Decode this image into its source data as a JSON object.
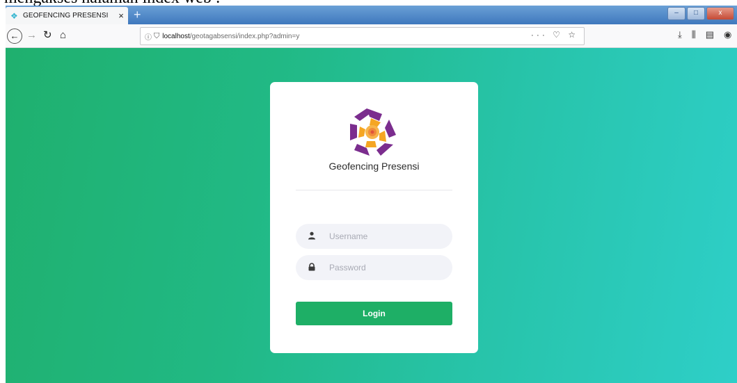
{
  "document_caption": "mengakses halaman index web :",
  "browser": {
    "tab_title": "GEOFENCING PRESENSI",
    "tab_close": "×",
    "new_tab": "+",
    "window_title": "",
    "url_info": "ⓘ",
    "url_host": "localhost",
    "url_path": "/geotagabsensi/index.php?admin=y",
    "url_actions": "··· ♡ ☆"
  },
  "page": {
    "app_name": "Geofencing Presensi",
    "username_placeholder": "Username",
    "password_placeholder": "Password",
    "login_label": "Login"
  },
  "colors": {
    "gradient_start": "#1fb06e",
    "gradient_end": "#2ecfc8",
    "login_button": "#1eaf66",
    "logo_purple": "#7b2d8e",
    "logo_orange": "#f5a623"
  }
}
